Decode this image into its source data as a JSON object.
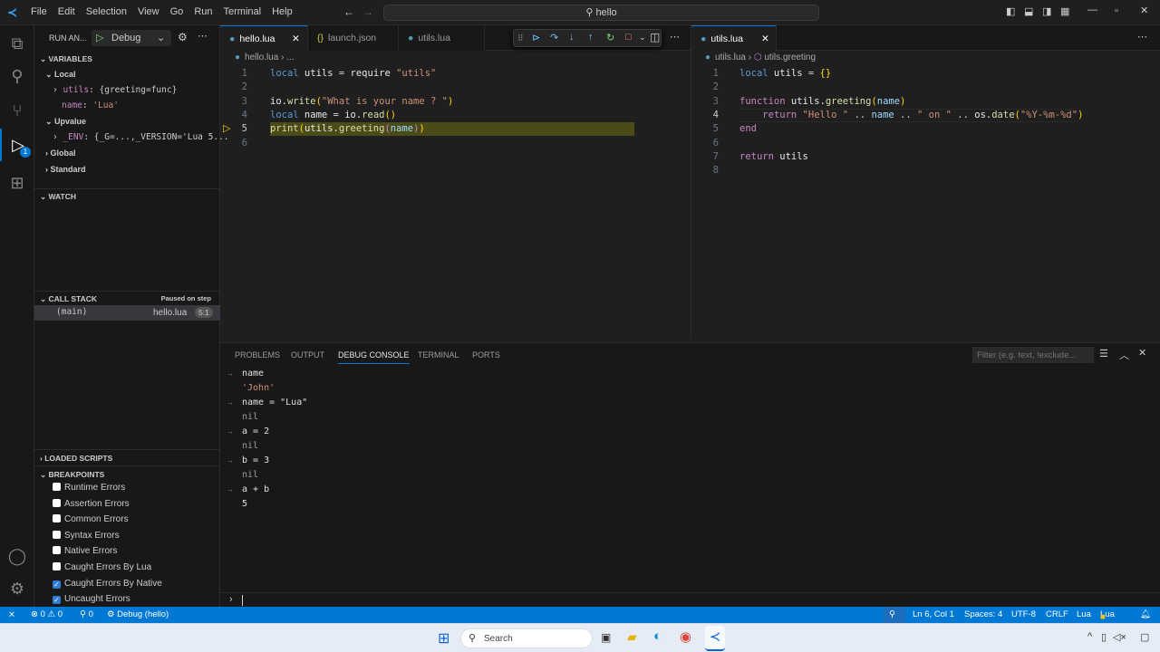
{
  "menu": [
    "File",
    "Edit",
    "Selection",
    "View",
    "Go",
    "Run",
    "Terminal",
    "Help"
  ],
  "command_center": "hello",
  "sidebar": {
    "run_label": "RUN AN...",
    "config": "Debug",
    "variables_title": "VARIABLES",
    "local": "Local",
    "vars": [
      {
        "name": "utils",
        "value": "{greeting=func}"
      },
      {
        "name": "name",
        "value": "'Lua'"
      }
    ],
    "upvalue": "Upvalue",
    "env": {
      "name": "_ENV",
      "value": "{_G=...,_VERSION='Lua 5..."
    },
    "global": "Global",
    "standard": "Standard",
    "watch_title": "WATCH",
    "callstack_title": "CALL STACK",
    "paused": "Paused on step",
    "frame": {
      "name": "(main)",
      "file": "hello.lua",
      "pos": "5:1"
    },
    "loaded_scripts": "LOADED SCRIPTS",
    "breakpoints_title": "BREAKPOINTS",
    "breakpoints": [
      {
        "label": "Runtime Errors",
        "checked": false
      },
      {
        "label": "Assertion Errors",
        "checked": false
      },
      {
        "label": "Common Errors",
        "checked": false
      },
      {
        "label": "Syntax Errors",
        "checked": false
      },
      {
        "label": "Native Errors",
        "checked": false
      },
      {
        "label": "Caught Errors By Lua",
        "checked": false
      },
      {
        "label": "Caught Errors By Native",
        "checked": true
      },
      {
        "label": "Uncaught Errors",
        "checked": true
      }
    ],
    "debug_badge": "1"
  },
  "editor1": {
    "tabs": [
      "hello.lua",
      "launch.json",
      "utils.lua"
    ],
    "breadcrumb": [
      "hello.lua",
      "..."
    ],
    "current_line": 5,
    "lines": [
      [
        [
          "kw",
          "local"
        ],
        [
          "id",
          " utils "
        ],
        [
          "op",
          "= "
        ],
        [
          "id",
          "require "
        ],
        [
          "str",
          "\"utils\""
        ]
      ],
      [],
      [
        [
          "id",
          "io."
        ],
        [
          "fn",
          "write"
        ],
        [
          "br",
          "("
        ],
        [
          "str",
          "\"What is your name ? \""
        ],
        [
          "br",
          ")"
        ]
      ],
      [
        [
          "kw",
          "local"
        ],
        [
          "id",
          " name "
        ],
        [
          "op",
          "= "
        ],
        [
          "id",
          "io."
        ],
        [
          "fn",
          "read"
        ],
        [
          "br",
          "()"
        ]
      ],
      [
        [
          "fn",
          "print"
        ],
        [
          "br",
          "("
        ],
        [
          "id",
          "utils."
        ],
        [
          "fn",
          "greeting"
        ],
        [
          "ctl",
          "("
        ],
        [
          "var",
          "name"
        ],
        [
          "ctl",
          ")"
        ],
        [
          "br",
          ")"
        ]
      ],
      []
    ]
  },
  "editor2": {
    "tab": "utils.lua",
    "breadcrumb": [
      "utils.lua",
      "utils.greeting"
    ],
    "current_line": 4,
    "lines": [
      [
        [
          "kw",
          "local"
        ],
        [
          "id",
          " utils "
        ],
        [
          "op",
          "= "
        ],
        [
          "br",
          "{}"
        ]
      ],
      [],
      [
        [
          "ctl",
          "function"
        ],
        [
          "id",
          " utils."
        ],
        [
          "fn",
          "greeting"
        ],
        [
          "br",
          "("
        ],
        [
          "var",
          "name"
        ],
        [
          "br",
          ")"
        ]
      ],
      [
        [
          "op",
          "    "
        ],
        [
          "ctl",
          "return"
        ],
        [
          "str",
          " \"Hello \""
        ],
        [
          "op",
          " .. "
        ],
        [
          "var",
          "name"
        ],
        [
          "op",
          " .. "
        ],
        [
          "str",
          "\" on \""
        ],
        [
          "op",
          " .. "
        ],
        [
          "id",
          "os."
        ],
        [
          "fn",
          "date"
        ],
        [
          "br",
          "("
        ],
        [
          "str",
          "\"%Y-%m-%d\""
        ],
        [
          "br",
          ")"
        ]
      ],
      [
        [
          "ctl",
          "end"
        ]
      ],
      [],
      [
        [
          "ctl",
          "return"
        ],
        [
          "id",
          " utils"
        ]
      ],
      []
    ]
  },
  "panel": {
    "tabs": [
      "PROBLEMS",
      "OUTPUT",
      "DEBUG CONSOLE",
      "TERMINAL",
      "PORTS"
    ],
    "filter_placeholder": "Filter (e.g. text, !exclude...",
    "console": [
      {
        "in": true,
        "text": "name"
      },
      {
        "in": false,
        "text": "'John'",
        "cls": "str"
      },
      {
        "in": true,
        "text": "name = \"Lua\""
      },
      {
        "in": false,
        "text": "nil",
        "cls": "nil"
      },
      {
        "in": true,
        "text": "a = 2"
      },
      {
        "in": false,
        "text": "nil",
        "cls": "nil"
      },
      {
        "in": true,
        "text": "b = 3"
      },
      {
        "in": false,
        "text": "nil",
        "cls": "nil"
      },
      {
        "in": true,
        "text": "a + b"
      },
      {
        "in": false,
        "text": "5"
      }
    ]
  },
  "status": {
    "errors": "0",
    "warnings": "0",
    "ports": "0",
    "debug": "Debug (hello)",
    "position": "Ln 6, Col 1",
    "spaces": "Spaces: 4",
    "encoding": "UTF-8",
    "eol": "CRLF",
    "language": "Lua",
    "ext": "Lua"
  },
  "taskbar": {
    "search": "Search"
  }
}
